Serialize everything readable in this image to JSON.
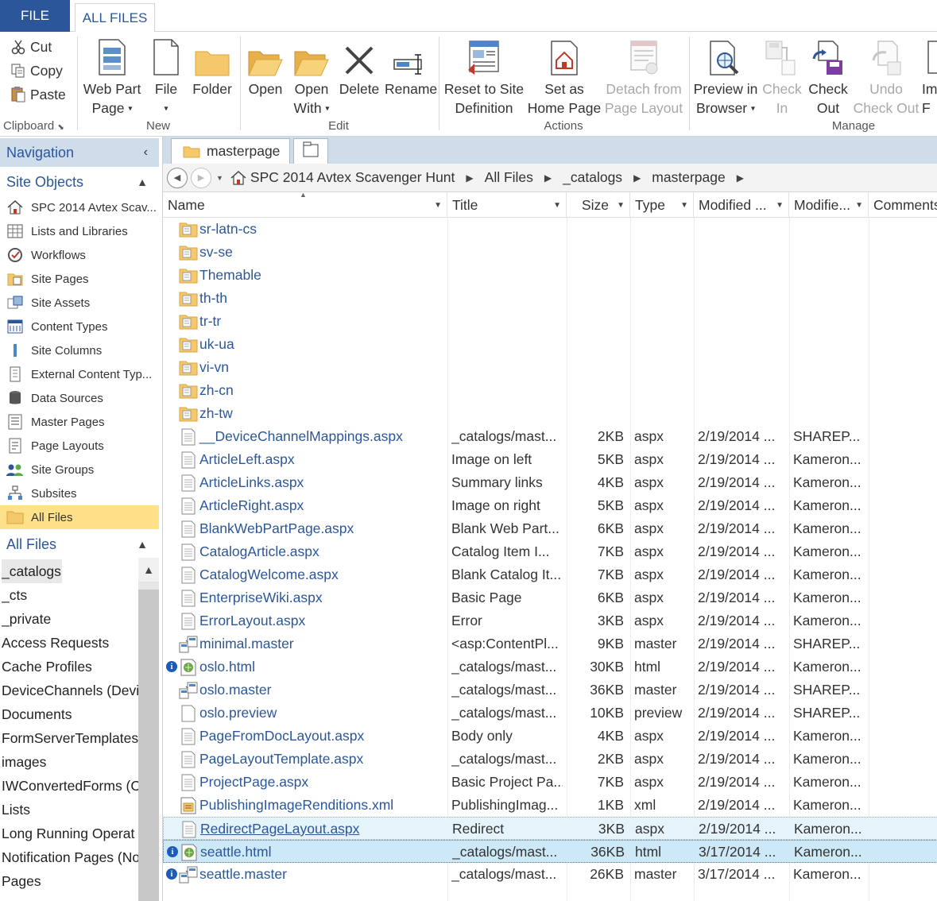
{
  "tabs": {
    "file": "FILE",
    "all_files": "ALL FILES"
  },
  "ribbon": {
    "clipboard": {
      "cut": "Cut",
      "copy": "Copy",
      "paste": "Paste",
      "label": "Clipboard"
    },
    "new": {
      "web_part_page_1": "Web Part",
      "web_part_page_2": "Page",
      "file": "File",
      "folder": "Folder",
      "label": "New"
    },
    "edit": {
      "open": "Open",
      "open_with_1": "Open",
      "open_with_2": "With",
      "delete": "Delete",
      "rename": "Rename",
      "label": "Edit"
    },
    "actions": {
      "reset_1": "Reset to Site",
      "reset_2": "Definition",
      "set_home_1": "Set as",
      "set_home_2": "Home Page",
      "detach_1": "Detach from",
      "detach_2": "Page Layout",
      "label": "Actions"
    },
    "manage": {
      "preview_1": "Preview in",
      "preview_2": "Browser",
      "check_in_1": "Check",
      "check_in_2": "In",
      "check_out_1": "Check",
      "check_out_2": "Out",
      "undo_1": "Undo",
      "undo_2": "Check Out",
      "import_1": "Im",
      "import_2": "F",
      "label": "Manage"
    }
  },
  "nav": {
    "title": "Navigation",
    "site_objects_label": "Site Objects",
    "site_objects": [
      {
        "label": "SPC 2014 Avtex Scav...",
        "icon": "home-icon"
      },
      {
        "label": "Lists and Libraries",
        "icon": "list-icon"
      },
      {
        "label": "Workflows",
        "icon": "workflow-icon"
      },
      {
        "label": "Site Pages",
        "icon": "site-pages-icon"
      },
      {
        "label": "Site Assets",
        "icon": "site-assets-icon"
      },
      {
        "label": "Content Types",
        "icon": "content-types-icon"
      },
      {
        "label": "Site Columns",
        "icon": "site-columns-icon"
      },
      {
        "label": "External Content Typ...",
        "icon": "external-content-icon"
      },
      {
        "label": "Data Sources",
        "icon": "database-icon"
      },
      {
        "label": "Master Pages",
        "icon": "master-pages-icon"
      },
      {
        "label": "Page Layouts",
        "icon": "page-layouts-icon"
      },
      {
        "label": "Site Groups",
        "icon": "site-groups-icon"
      },
      {
        "label": "Subsites",
        "icon": "subsites-icon"
      },
      {
        "label": "All Files",
        "icon": "folder-icon"
      }
    ],
    "all_files_label": "All Files",
    "tree": [
      "_catalogs",
      "_cts",
      "_private",
      "Access Requests",
      "Cache Profiles",
      "DeviceChannels (Devic",
      "Documents",
      "FormServerTemplates",
      "images",
      "IWConvertedForms (C",
      "Lists",
      "Long Running Operat",
      "Notification Pages (No",
      "Pages"
    ]
  },
  "doc_tab": {
    "label": "masterpage"
  },
  "breadcrumb": [
    "SPC 2014 Avtex Scavenger Hunt",
    "All Files",
    "_catalogs",
    "masterpage"
  ],
  "columns": {
    "name": "Name",
    "title": "Title",
    "size": "Size",
    "type": "Type",
    "modified": "Modified ...",
    "modified_by": "Modifie...",
    "comments": "Comments"
  },
  "folders": [
    "sr-latn-cs",
    "sv-se",
    "Themable",
    "th-th",
    "tr-tr",
    "uk-ua",
    "vi-vn",
    "zh-cn",
    "zh-tw"
  ],
  "files": [
    {
      "name": "__DeviceChannelMappings.aspx",
      "title": "_catalogs/mast...",
      "size": "2KB",
      "type": "aspx",
      "modified": "2/19/2014 ...",
      "by": "SHAREP...",
      "icon": "page-icon",
      "info": false
    },
    {
      "name": "ArticleLeft.aspx",
      "title": "Image on left",
      "size": "5KB",
      "type": "aspx",
      "modified": "2/19/2014 ...",
      "by": "Kameron...",
      "icon": "page-icon",
      "info": false
    },
    {
      "name": "ArticleLinks.aspx",
      "title": "Summary links",
      "size": "4KB",
      "type": "aspx",
      "modified": "2/19/2014 ...",
      "by": "Kameron...",
      "icon": "page-icon",
      "info": false
    },
    {
      "name": "ArticleRight.aspx",
      "title": "Image on right",
      "size": "5KB",
      "type": "aspx",
      "modified": "2/19/2014 ...",
      "by": "Kameron...",
      "icon": "page-icon",
      "info": false
    },
    {
      "name": "BlankWebPartPage.aspx",
      "title": "Blank Web Part...",
      "size": "6KB",
      "type": "aspx",
      "modified": "2/19/2014 ...",
      "by": "Kameron...",
      "icon": "page-icon",
      "info": false
    },
    {
      "name": "CatalogArticle.aspx",
      "title": "Catalog Item I...",
      "size": "7KB",
      "type": "aspx",
      "modified": "2/19/2014 ...",
      "by": "Kameron...",
      "icon": "page-icon",
      "info": false
    },
    {
      "name": "CatalogWelcome.aspx",
      "title": "Blank Catalog It...",
      "size": "7KB",
      "type": "aspx",
      "modified": "2/19/2014 ...",
      "by": "Kameron...",
      "icon": "page-icon",
      "info": false
    },
    {
      "name": "EnterpriseWiki.aspx",
      "title": "Basic Page",
      "size": "6KB",
      "type": "aspx",
      "modified": "2/19/2014 ...",
      "by": "Kameron...",
      "icon": "page-icon",
      "info": false
    },
    {
      "name": "ErrorLayout.aspx",
      "title": "Error",
      "size": "3KB",
      "type": "aspx",
      "modified": "2/19/2014 ...",
      "by": "Kameron...",
      "icon": "page-icon",
      "info": false
    },
    {
      "name": "minimal.master",
      "title": "<asp:ContentPl...",
      "size": "9KB",
      "type": "master",
      "modified": "2/19/2014 ...",
      "by": "SHAREP...",
      "icon": "master-icon",
      "info": false
    },
    {
      "name": "oslo.html",
      "title": "_catalogs/mast...",
      "size": "30KB",
      "type": "html",
      "modified": "2/19/2014 ...",
      "by": "Kameron...",
      "icon": "html-icon",
      "info": true
    },
    {
      "name": "oslo.master",
      "title": "_catalogs/mast...",
      "size": "36KB",
      "type": "master",
      "modified": "2/19/2014 ...",
      "by": "SHAREP...",
      "icon": "master-icon",
      "info": false
    },
    {
      "name": "oslo.preview",
      "title": "_catalogs/mast...",
      "size": "10KB",
      "type": "preview",
      "modified": "2/19/2014 ...",
      "by": "SHAREP...",
      "icon": "blank-file-icon",
      "info": false
    },
    {
      "name": "PageFromDocLayout.aspx",
      "title": "Body only",
      "size": "4KB",
      "type": "aspx",
      "modified": "2/19/2014 ...",
      "by": "Kameron...",
      "icon": "page-icon",
      "info": false
    },
    {
      "name": "PageLayoutTemplate.aspx",
      "title": "_catalogs/mast...",
      "size": "2KB",
      "type": "aspx",
      "modified": "2/19/2014 ...",
      "by": "Kameron...",
      "icon": "page-icon",
      "info": false
    },
    {
      "name": "ProjectPage.aspx",
      "title": "Basic Project Pa...",
      "size": "7KB",
      "type": "aspx",
      "modified": "2/19/2014 ...",
      "by": "Kameron...",
      "icon": "page-icon",
      "info": false
    },
    {
      "name": "PublishingImageRenditions.xml",
      "title": "PublishingImag...",
      "size": "1KB",
      "type": "xml",
      "modified": "2/19/2014 ...",
      "by": "Kameron...",
      "icon": "xml-icon",
      "info": false
    },
    {
      "name": "RedirectPageLayout.aspx",
      "title": "Redirect",
      "size": "3KB",
      "type": "aspx",
      "modified": "2/19/2014 ...",
      "by": "Kameron...",
      "icon": "page-icon",
      "info": false
    },
    {
      "name": "seattle.html",
      "title": "_catalogs/mast...",
      "size": "36KB",
      "type": "html",
      "modified": "3/17/2014 ...",
      "by": "Kameron...",
      "icon": "html-icon",
      "info": true
    },
    {
      "name": "seattle.master",
      "title": "_catalogs/mast...",
      "size": "26KB",
      "type": "master",
      "modified": "3/17/2014 ...",
      "by": "Kameron...",
      "icon": "master-icon",
      "info": true
    }
  ],
  "colors": {
    "accent": "#2b579a",
    "nav_header_bg": "#cfdcea",
    "selected_nav": "#ffe189",
    "folder": "#f4c86b",
    "row_hover": "#e5f3fb",
    "row_selected": "#cde8f6",
    "info_badge": "#1e5bb8"
  }
}
